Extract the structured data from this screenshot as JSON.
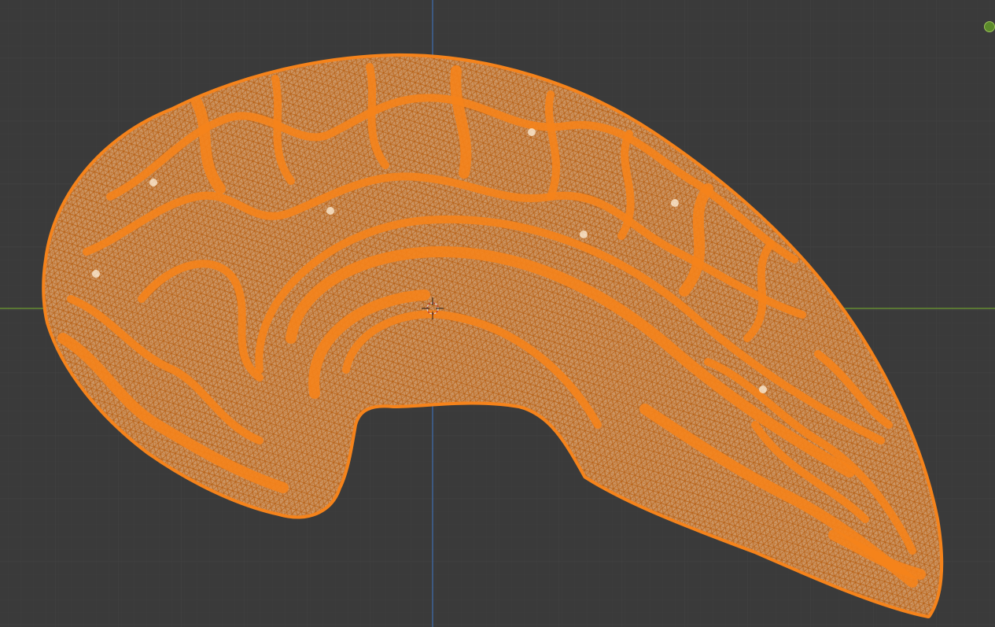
{
  "viewport": {
    "background_color": "#3a3a3a",
    "grid_color": "#424242",
    "subgrid_color": "#3e3e3e",
    "x_axis_color": "#6e9c32",
    "y_axis_color": "#3f6eb0",
    "object": {
      "name": "",
      "selection_color": "#f5831b",
      "surface_color": "#a9a49e",
      "wire_color": "#b85f12",
      "highlight_color": "#fff1dc"
    },
    "cursor_icon": "3d-cursor-icon",
    "gizmo": {
      "icon": "navigation-gizmo-icon",
      "color": "#5b8a2a"
    }
  }
}
